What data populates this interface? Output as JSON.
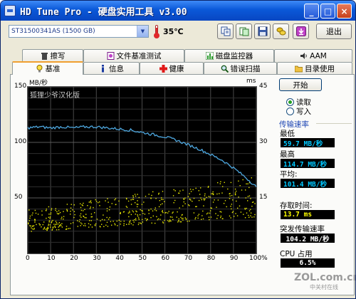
{
  "window": {
    "title": "HD Tune Pro - 硬盘实用工具 v3.00",
    "minimize": "_",
    "restore": "□",
    "close": "×"
  },
  "toolbar": {
    "drive": "ST31500341AS (1500 GB)",
    "temperature": "35℃",
    "exit_label": "退出"
  },
  "tabs_top": [
    "擦写",
    "文件基准测试",
    "磁盘监控器",
    "AAM"
  ],
  "tabs_bottom": [
    "基准",
    "信息",
    "健康",
    "错误扫描",
    "目录使用"
  ],
  "chart_data": {
    "type": "scatter",
    "title": "",
    "xlabel": "",
    "ylabel_left": "MB/秒",
    "ylabel_right": "ms",
    "x_ticks": [
      "0",
      "10",
      "20",
      "30",
      "40",
      "50",
      "60",
      "70",
      "80",
      "90",
      "100%"
    ],
    "y_left_ticks": [
      "50",
      "100",
      "150"
    ],
    "y_right_ticks": [
      "15",
      "30",
      "45"
    ],
    "xlim": [
      0,
      100
    ],
    "ylim_left": [
      0,
      150
    ],
    "ylim_right": [
      0,
      45
    ],
    "grid": true,
    "series": [
      {
        "name": "传输速率",
        "type": "line",
        "color": "#4ea8e0",
        "x": [
          0,
          5,
          10,
          15,
          20,
          25,
          30,
          35,
          40,
          45,
          50,
          55,
          60,
          65,
          70,
          75,
          80,
          85,
          90,
          95,
          100
        ],
        "y": [
          113,
          114,
          113,
          114,
          113,
          114,
          114,
          113,
          112,
          111,
          109,
          107,
          105,
          102,
          98,
          94,
          89,
          84,
          77,
          69,
          60
        ]
      },
      {
        "name": "存取时间",
        "type": "scatter",
        "color": "#e6e600",
        "x_range": [
          0,
          100
        ],
        "y_range_ms": [
          6,
          21
        ]
      }
    ]
  },
  "watermark": "狐狸少爷汉化版",
  "controls": {
    "start_label": "开始",
    "read_label": "读取",
    "write_label": "写入",
    "read_selected": true
  },
  "stats": {
    "group_title": "传输速率",
    "min_label": "最低",
    "min_value": "59.7 MB/秒",
    "max_label": "最高",
    "max_value": "114.7 MB/秒",
    "avg_label": "平均:",
    "avg_value": "101.4 MB/秒",
    "access_label": "存取时间:",
    "access_value": "13.7 ms",
    "burst_label": "突发传输速率",
    "burst_value": "104.2 MB/秒",
    "cpu_label": "CPU 占用",
    "cpu_value": "6.5%"
  },
  "logo": {
    "main": "ZOL.com.cn",
    "sub": "中关村在线"
  },
  "colors": {
    "titlebar": "#0a58d8",
    "chart_bg": "#000000",
    "transfer_line": "#4ea8e0",
    "access_dots": "#e6e600",
    "stat_text": "#00c8ff"
  }
}
